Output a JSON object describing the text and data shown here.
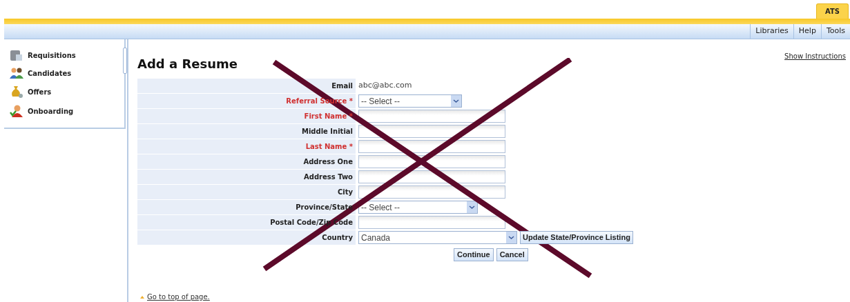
{
  "top_tabs": [
    {
      "label": "ATS",
      "selected": true
    }
  ],
  "menu": [
    {
      "label": "Libraries"
    },
    {
      "label": "Help"
    },
    {
      "label": "Tools"
    }
  ],
  "sidebar": {
    "items": [
      {
        "label": "Requisitions"
      },
      {
        "label": "Candidates"
      },
      {
        "label": "Offers"
      },
      {
        "label": "Onboarding"
      }
    ]
  },
  "page": {
    "title": "Add a Resume",
    "show_instructions": "Show Instructions"
  },
  "form": {
    "rows": [
      {
        "label": "Email",
        "required": false,
        "kind": "text",
        "value": "abc@abc.com"
      },
      {
        "label": "Referral Source *",
        "required": true,
        "kind": "select",
        "value": "-- Select --"
      },
      {
        "label": "First Name *",
        "required": true,
        "kind": "input"
      },
      {
        "label": "Middle Initial",
        "required": false,
        "kind": "input"
      },
      {
        "label": "Last Name *",
        "required": true,
        "kind": "input"
      },
      {
        "label": "Address One",
        "required": false,
        "kind": "input"
      },
      {
        "label": "Address Two",
        "required": false,
        "kind": "input"
      },
      {
        "label": "City",
        "required": false,
        "kind": "input"
      },
      {
        "label": "Province/State",
        "required": false,
        "kind": "select",
        "value": "-- Select --"
      },
      {
        "label": "Postal Code/Zip Code",
        "required": false,
        "kind": "input"
      },
      {
        "label": "Country",
        "required": false,
        "kind": "select",
        "value": "Canada",
        "button": "Update State/Province Listing"
      }
    ],
    "buttons": [
      "Continue",
      "Cancel"
    ]
  },
  "footer_link": "Go to top of page."
}
